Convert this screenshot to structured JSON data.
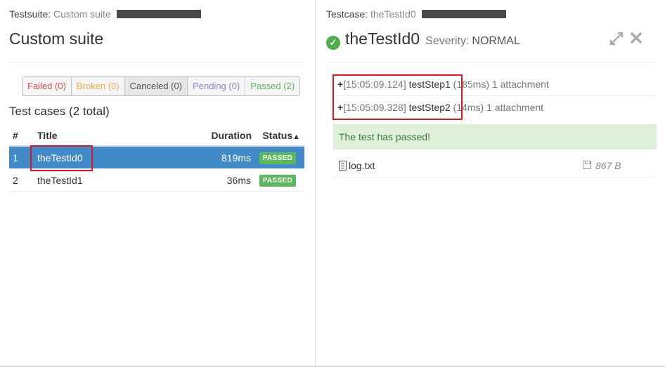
{
  "left": {
    "crumb_label": "Testsuite:",
    "crumb_value": "Custom suite",
    "title": "Custom suite",
    "filters": [
      {
        "label": "Failed (0)"
      },
      {
        "label": "Broken (0)"
      },
      {
        "label": "Canceled (0)"
      },
      {
        "label": "Pending (0)"
      },
      {
        "label": "Passed (2)"
      }
    ],
    "cases_title": "Test cases (2 total)",
    "columns": {
      "num": "#",
      "title": "Title",
      "duration": "Duration",
      "status": "Status"
    },
    "sort_arrow": "▲",
    "rows": [
      {
        "num": "1",
        "title": "theTestId0",
        "duration": "819ms",
        "status": "PASSED"
      },
      {
        "num": "2",
        "title": "theTestId1",
        "duration": "36ms",
        "status": "PASSED"
      }
    ]
  },
  "right": {
    "crumb_label": "Testcase:",
    "crumb_value": "theTestId0",
    "title": "theTestId0",
    "severity_label": "Severity:",
    "severity_value": "NORMAL",
    "steps": [
      {
        "plus": "+",
        "time": "[15:05:09.124]",
        "name": "testStep1",
        "meta": "(185ms) 1 attachment"
      },
      {
        "plus": "+",
        "time": "[15:05:09.328]",
        "name": "testStep2",
        "meta": "(14ms) 1 attachment"
      }
    ],
    "alert": "The test has passed!",
    "attachment": {
      "name": "log.txt",
      "size": "867 B"
    }
  },
  "icons": {
    "check": "check-circle-icon",
    "expand": "expand-icon",
    "close": "close-icon",
    "file": "file-icon",
    "save": "floppy-icon"
  },
  "colors": {
    "selected_row": "#428bca",
    "passed": "#5cb85c",
    "highlight": "#e8141b"
  }
}
